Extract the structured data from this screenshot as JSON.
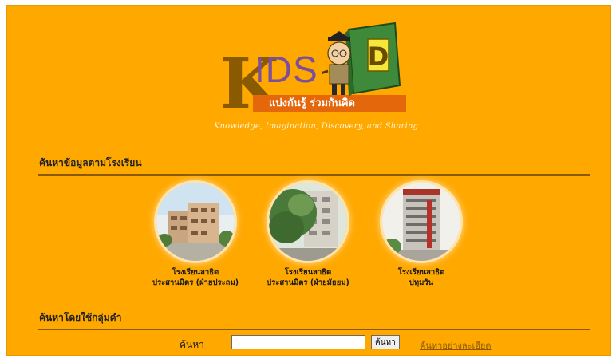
{
  "header": {
    "logo_text": "KIDS",
    "logo_letter": "D",
    "tagline": "แบ่งกันรู้ ร่วมกันคิด",
    "subtitle": "Knowledge, Imagination, Discovery, and Sharing"
  },
  "schools_section": {
    "title": "ค้นหาข้อมูลตามโรงเรียน",
    "schools": [
      {
        "line1": "โรงเรียนสาธิต",
        "line2": "ประสานมิตร (ฝ่ายประถม)"
      },
      {
        "line1": "โรงเรียนสาธิต",
        "line2": "ประสานมิตร (ฝ่ายมัธยม)"
      },
      {
        "line1": "โรงเรียนสาธิต",
        "line2": "ปทุมวัน"
      }
    ]
  },
  "keyword_section": {
    "title": "ค้นหาโดยใช้กลุ่มคำ",
    "search_label": "ค้นหา",
    "search_value": "",
    "search_button": "ค้นหา",
    "advanced_link": "ค้นหาอย่างละเอียด"
  },
  "colors": {
    "background": "#ffa800",
    "rule": "#8a5a00",
    "tag_bar": "#e5670c"
  }
}
